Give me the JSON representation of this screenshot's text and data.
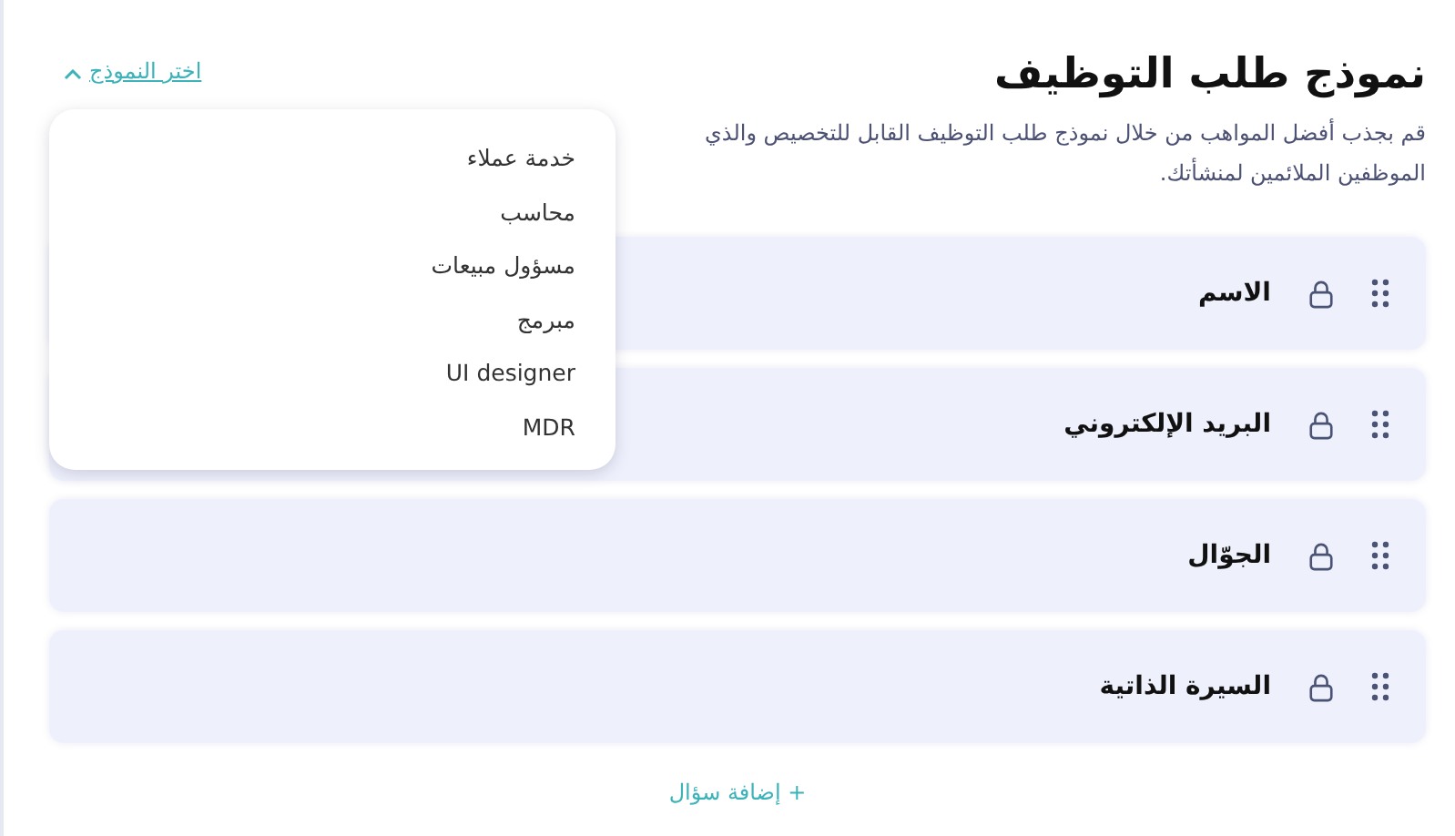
{
  "header": {
    "title": "نموذج طلب التوظيف",
    "description_lines": [
      "قم بجذب أفضل المواهب من خلال نموذج طلب التوظيف القابل للتخصيص والذي",
      "الموظفين الملائمين لمنشأتك."
    ],
    "template_link": "اختر النموذج"
  },
  "template_menu": {
    "expanded": true,
    "items": [
      "خدمة عملاء",
      "محاسب",
      "مسؤول مبيعات",
      "مبرمج",
      "UI designer",
      "MDR"
    ]
  },
  "questions": [
    {
      "label": "الاسم",
      "locked": true
    },
    {
      "label": "البريد الإلكتروني",
      "locked": true
    },
    {
      "label": "الجوّال",
      "locked": true
    },
    {
      "label": "السيرة الذاتية",
      "locked": true
    }
  ],
  "add_question": "+ إضافة سؤال"
}
